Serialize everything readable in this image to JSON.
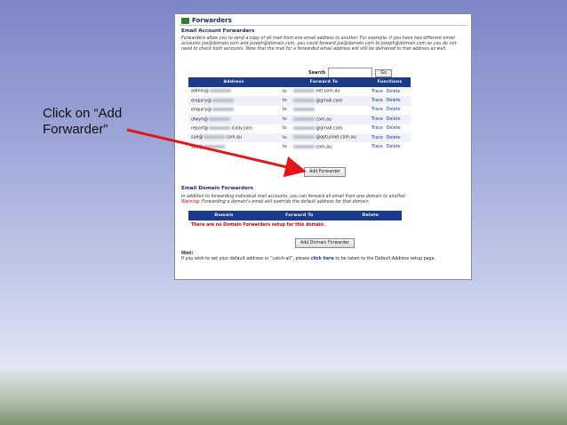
{
  "slide": {
    "caption": "Click on “Add Forwarder”"
  },
  "cpanel": {
    "title": "Forwarders",
    "account_section_title": "Email Account Forwarders",
    "account_description": "Forwarders allow you to send a copy of all mail from one email address to another. For example, if you have two different email accounts joe@domain.com and joseph@domain.com, you could forward joe@domain.com to joseph@domain.com so you do not need to check both accounts. Note that the mail for a forwarded email address will still be delivered to that address as well.",
    "search": {
      "label": "Search",
      "go_label": "Go",
      "value": ""
    },
    "forwarders_table": {
      "headers": [
        "Address",
        "Forward To",
        "Functions"
      ],
      "to_word": "to",
      "trace_label": "Trace",
      "delete_label": "Delete",
      "rows": [
        {
          "address_prefix": "admin@",
          "address_suffix": "",
          "forward_prefix": "",
          "forward_suffix": "net.com.au"
        },
        {
          "address_prefix": "enquiry@",
          "address_suffix": "",
          "forward_prefix": "",
          "forward_suffix": "@gmail.com"
        },
        {
          "address_prefix": "enquiry@",
          "address_suffix": "",
          "forward_prefix": "",
          "forward_suffix": ""
        },
        {
          "address_prefix": "olwyn@",
          "address_suffix": "",
          "forward_prefix": "",
          "forward_suffix": "com.au"
        },
        {
          "address_prefix": "report@",
          "address_suffix": "ically.com",
          "forward_prefix": "",
          "forward_suffix": "@gmail.com"
        },
        {
          "address_prefix": "sue@",
          "address_suffix": "com.au",
          "forward_prefix": "",
          "forward_suffix": "@optusnet.com.au"
        },
        {
          "address_prefix": "sue@",
          "address_suffix": "",
          "forward_prefix": "",
          "forward_suffix": "com.au"
        }
      ]
    },
    "add_forwarder_label": "Add Forwarder",
    "domain_section_title": "Email Domain Forwarders",
    "domain_description": "In addition to forwarding individual mail accounts, you can forward all email from one domain to another.",
    "domain_warning_label": "Warning:",
    "domain_warning": "Forwarding a domain's email will override the default address for that domain.",
    "domain_table": {
      "headers": [
        "Domain",
        "Forward To",
        "Delete"
      ],
      "empty_message": "There are no Domain Forwarders setup for this domain."
    },
    "add_domain_forwarder_label": "Add Domain Forwarder",
    "hint": {
      "title": "Hint:",
      "text_before": "If you wish to set your default address or “catch-all”, please",
      "link": "click here",
      "text_after": "to be taken to the Default Address setup page."
    }
  },
  "colors": {
    "header_blue": "#1b3a8a",
    "arrow_red": "#e01818",
    "link_blue": "#1a3a9a"
  }
}
